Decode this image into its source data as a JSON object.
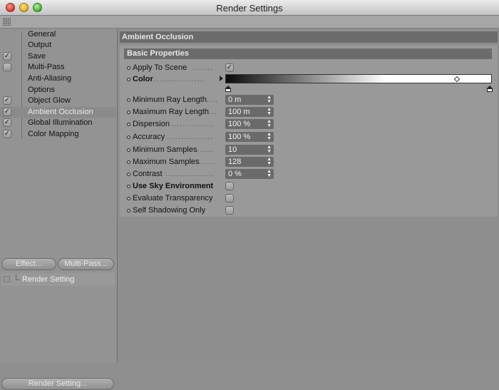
{
  "window": {
    "title": "Render Settings"
  },
  "sidebar": {
    "items": [
      {
        "label": "General",
        "checkbox": false,
        "checked": false,
        "active": false
      },
      {
        "label": "Output",
        "checkbox": false,
        "checked": false,
        "active": false
      },
      {
        "label": "Save",
        "checkbox": true,
        "checked": true,
        "active": false
      },
      {
        "label": "Multi-Pass",
        "checkbox": true,
        "checked": false,
        "active": false
      },
      {
        "label": "Anti-Aliasing",
        "checkbox": false,
        "checked": false,
        "active": false
      },
      {
        "label": "Options",
        "checkbox": false,
        "checked": false,
        "active": false
      },
      {
        "label": "Object Glow",
        "checkbox": true,
        "checked": true,
        "active": false
      },
      {
        "label": "Ambient Occlusion",
        "checkbox": true,
        "checked": true,
        "active": true
      },
      {
        "label": "Global Illumination",
        "checkbox": true,
        "checked": true,
        "active": false
      },
      {
        "label": "Color Mapping",
        "checkbox": true,
        "checked": true,
        "active": false
      }
    ],
    "effect_button": "Effect...",
    "multipass_button": "Multi-Pass...",
    "preset_item": "Render Setting",
    "render_setting_button": "Render Setting..."
  },
  "main": {
    "section_title": "Ambient Occlusion",
    "group_title": "Basic Properties",
    "apply_to_scene": {
      "label": "Apply To Scene",
      "checked": true
    },
    "color": {
      "label": "Color"
    },
    "min_ray_length": {
      "label": "Minimum Ray Length",
      "value": "0 m"
    },
    "max_ray_length": {
      "label": "Maximum Ray Length",
      "value": "100 m"
    },
    "dispersion": {
      "label": "Dispersion",
      "value": "100 %"
    },
    "accuracy": {
      "label": "Accuracy",
      "value": "100 %"
    },
    "min_samples": {
      "label": "Minimum Samples",
      "value": "10"
    },
    "max_samples": {
      "label": "Maximum Samples",
      "value": "128"
    },
    "contrast": {
      "label": "Contrast",
      "value": "0 %"
    },
    "use_sky_environment": {
      "label": "Use Sky Environment",
      "checked": false
    },
    "evaluate_transparency": {
      "label": "Evaluate Transparency",
      "checked": false
    },
    "self_shadowing_only": {
      "label": "Self Shadowing Only",
      "checked": false
    }
  }
}
